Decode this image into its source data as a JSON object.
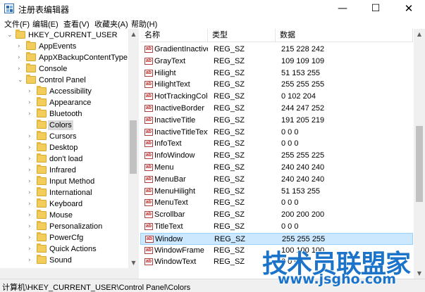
{
  "window": {
    "title": "注册表编辑器",
    "min_glyph": "—",
    "max_glyph": "☐",
    "close_glyph": "✕"
  },
  "menu": [
    "文件(F)",
    "编辑(E)",
    "查看(V)",
    "收藏夹(A)",
    "帮助(H)"
  ],
  "tree": {
    "items": [
      {
        "label": "HKEY_CURRENT_USER",
        "depth": 0,
        "expanded": true
      },
      {
        "label": "AppEvents",
        "depth": 1,
        "expanded": false
      },
      {
        "label": "AppXBackupContentType",
        "depth": 1,
        "expanded": false
      },
      {
        "label": "Console",
        "depth": 1,
        "expanded": false
      },
      {
        "label": "Control Panel",
        "depth": 1,
        "expanded": true
      },
      {
        "label": "Accessibility",
        "depth": 2,
        "expanded": false
      },
      {
        "label": "Appearance",
        "depth": 2,
        "expanded": false
      },
      {
        "label": "Bluetooth",
        "depth": 2,
        "expanded": false
      },
      {
        "label": "Colors",
        "depth": 2,
        "expanded": false,
        "selected": true
      },
      {
        "label": "Cursors",
        "depth": 2,
        "expanded": false
      },
      {
        "label": "Desktop",
        "depth": 2,
        "expanded": false
      },
      {
        "label": "don't load",
        "depth": 2,
        "expanded": false
      },
      {
        "label": "Infrared",
        "depth": 2,
        "expanded": false
      },
      {
        "label": "Input Method",
        "depth": 2,
        "expanded": false
      },
      {
        "label": "International",
        "depth": 2,
        "expanded": false
      },
      {
        "label": "Keyboard",
        "depth": 2,
        "expanded": false
      },
      {
        "label": "Mouse",
        "depth": 2,
        "expanded": false
      },
      {
        "label": "Personalization",
        "depth": 2,
        "expanded": false
      },
      {
        "label": "PowerCfg",
        "depth": 2,
        "expanded": false
      },
      {
        "label": "Quick Actions",
        "depth": 2,
        "expanded": false
      },
      {
        "label": "Sound",
        "depth": 2,
        "expanded": false
      }
    ]
  },
  "columns": {
    "name": "名称",
    "type": "类型",
    "data": "数据"
  },
  "values": [
    {
      "name": "GradientInactiveTitle",
      "type": "REG_SZ",
      "data": "215 228 242"
    },
    {
      "name": "GrayText",
      "type": "REG_SZ",
      "data": "109 109 109"
    },
    {
      "name": "Hilight",
      "type": "REG_SZ",
      "data": "51 153 255"
    },
    {
      "name": "HilightText",
      "type": "REG_SZ",
      "data": "255 255 255"
    },
    {
      "name": "HotTrackingColor",
      "type": "REG_SZ",
      "data": "0 102 204"
    },
    {
      "name": "InactiveBorder",
      "type": "REG_SZ",
      "data": "244 247 252"
    },
    {
      "name": "InactiveTitle",
      "type": "REG_SZ",
      "data": "191 205 219"
    },
    {
      "name": "InactiveTitleText",
      "type": "REG_SZ",
      "data": "0 0 0"
    },
    {
      "name": "InfoText",
      "type": "REG_SZ",
      "data": "0 0 0"
    },
    {
      "name": "InfoWindow",
      "type": "REG_SZ",
      "data": "255 255 225"
    },
    {
      "name": "Menu",
      "type": "REG_SZ",
      "data": "240 240 240"
    },
    {
      "name": "MenuBar",
      "type": "REG_SZ",
      "data": "240 240 240"
    },
    {
      "name": "MenuHilight",
      "type": "REG_SZ",
      "data": "51 153 255"
    },
    {
      "name": "MenuText",
      "type": "REG_SZ",
      "data": "0 0 0"
    },
    {
      "name": "Scrollbar",
      "type": "REG_SZ",
      "data": "200 200 200"
    },
    {
      "name": "TitleText",
      "type": "REG_SZ",
      "data": "0 0 0"
    },
    {
      "name": "Window",
      "type": "REG_SZ",
      "data": "255 255 255",
      "selected": true
    },
    {
      "name": "WindowFrame",
      "type": "REG_SZ",
      "data": "100 100 100"
    },
    {
      "name": "WindowText",
      "type": "REG_SZ",
      "data": "0 0 0"
    }
  ],
  "value_icon": "ab",
  "status": {
    "path": "计算机\\HKEY_CURRENT_USER\\Control Panel\\Colors"
  },
  "watermark": {
    "main": "技术员联盟",
    "suffix": "家",
    "url": "www.jsgho.com"
  },
  "colors": {
    "selection": "#cce8ff",
    "tree_selection": "#d9d9d9",
    "folder": "#f3cd5c",
    "watermark": "#1b74c9"
  }
}
